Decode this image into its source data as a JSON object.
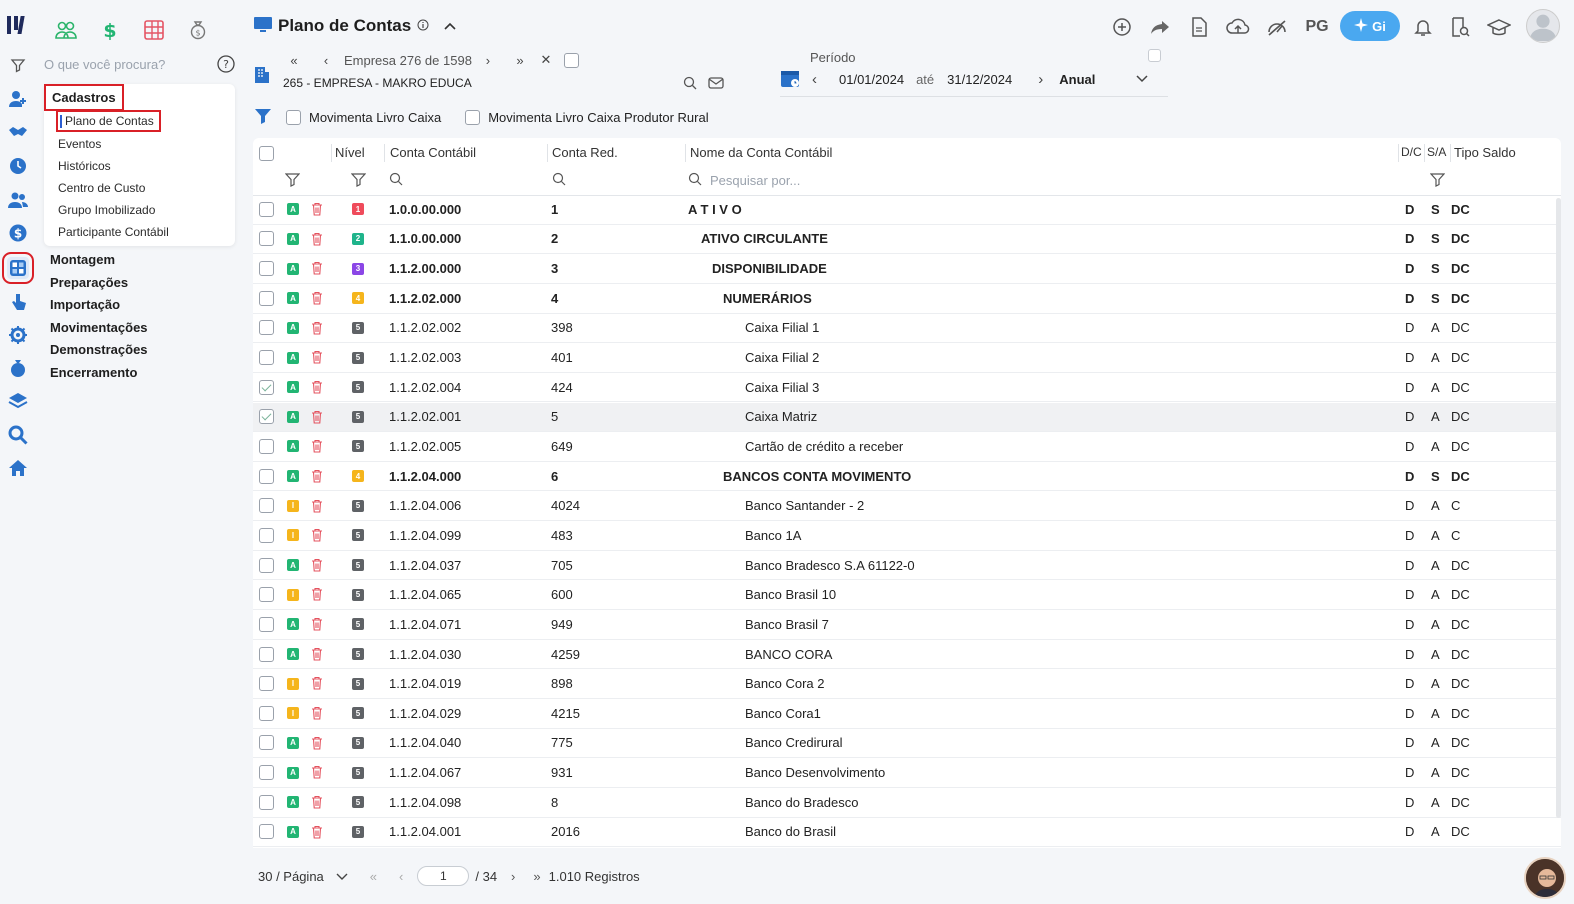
{
  "app": {
    "title": "Plano de Contas",
    "pg_label": "PG",
    "gi_label": "Gi"
  },
  "sidebar": {
    "search_placeholder": "O que você procura?",
    "submenu_header": "Cadastros",
    "submenu_items": [
      "Plano de Contas",
      "Eventos",
      "Históricos",
      "Centro de Custo",
      "Grupo Imobilizado",
      "Participante Contábil"
    ],
    "main_items": [
      "Montagem",
      "Preparações",
      "Importação",
      "Movimentações",
      "Demonstrações",
      "Encerramento"
    ]
  },
  "empresa": {
    "counter": "Empresa 276 de 1598",
    "name": "265 - EMPRESA - MAKRO EDUCA"
  },
  "periodo": {
    "label": "Período",
    "start": "01/01/2024",
    "sep": "até",
    "end": "31/12/2024",
    "type": "Anual"
  },
  "filters": {
    "livro_caixa": "Movimenta Livro Caixa",
    "livro_caixa_rural": "Movimenta Livro Caixa Produtor Rural"
  },
  "table": {
    "headers": {
      "nivel": "Nível",
      "conta": "Conta Contábil",
      "red": "Conta Red.",
      "nome": "Nome da Conta Contábil",
      "dc": "D/C",
      "sa": "S/A",
      "tipo": "Tipo Saldo"
    },
    "search_placeholder": "Pesquisar por...",
    "rows": [
      {
        "checked": false,
        "status": "A",
        "level": "1",
        "conta": "1.0.0.00.000",
        "red": "1",
        "nome": "A T I V O",
        "dc": "D",
        "sa": "S",
        "tipo": "DC",
        "bold": true
      },
      {
        "checked": false,
        "status": "A",
        "level": "2",
        "conta": "1.1.0.00.000",
        "red": "2",
        "nome": "ATIVO CIRCULANTE",
        "dc": "D",
        "sa": "S",
        "tipo": "DC",
        "bold": true
      },
      {
        "checked": false,
        "status": "A",
        "level": "3",
        "conta": "1.1.2.00.000",
        "red": "3",
        "nome": "DISPONIBILIDADE",
        "dc": "D",
        "sa": "S",
        "tipo": "DC",
        "bold": true
      },
      {
        "checked": false,
        "status": "A",
        "level": "4",
        "conta": "1.1.2.02.000",
        "red": "4",
        "nome": "NUMERÁRIOS",
        "dc": "D",
        "sa": "S",
        "tipo": "DC",
        "bold": true
      },
      {
        "checked": false,
        "status": "A",
        "level": "5",
        "conta": "1.1.2.02.002",
        "red": "398",
        "nome": "Caixa Filial 1",
        "dc": "D",
        "sa": "A",
        "tipo": "DC",
        "bold": false
      },
      {
        "checked": false,
        "status": "A",
        "level": "5",
        "conta": "1.1.2.02.003",
        "red": "401",
        "nome": "Caixa Filial 2",
        "dc": "D",
        "sa": "A",
        "tipo": "DC",
        "bold": false
      },
      {
        "checked": true,
        "status": "A",
        "level": "5",
        "conta": "1.1.2.02.004",
        "red": "424",
        "nome": "Caixa Filial 3",
        "dc": "D",
        "sa": "A",
        "tipo": "DC",
        "bold": false
      },
      {
        "checked": true,
        "status": "A",
        "level": "5",
        "conta": "1.1.2.02.001",
        "red": "5",
        "nome": "Caixa Matriz",
        "dc": "D",
        "sa": "A",
        "tipo": "DC",
        "bold": false,
        "hl": true
      },
      {
        "checked": false,
        "status": "A",
        "level": "5",
        "conta": "1.1.2.02.005",
        "red": "649",
        "nome": "Cartão de crédito a receber",
        "dc": "D",
        "sa": "A",
        "tipo": "DC",
        "bold": false
      },
      {
        "checked": false,
        "status": "A",
        "level": "4",
        "conta": "1.1.2.04.000",
        "red": "6",
        "nome": "BANCOS CONTA MOVIMENTO",
        "dc": "D",
        "sa": "S",
        "tipo": "DC",
        "bold": true
      },
      {
        "checked": false,
        "status": "I",
        "level": "5",
        "conta": "1.1.2.04.006",
        "red": "4024",
        "nome": "Banco Santander - 2",
        "dc": "D",
        "sa": "A",
        "tipo": "C",
        "bold": false
      },
      {
        "checked": false,
        "status": "I",
        "level": "5",
        "conta": "1.1.2.04.099",
        "red": "483",
        "nome": "Banco 1A",
        "dc": "D",
        "sa": "A",
        "tipo": "C",
        "bold": false
      },
      {
        "checked": false,
        "status": "A",
        "level": "5",
        "conta": "1.1.2.04.037",
        "red": "705",
        "nome": "Banco Bradesco S.A 61122-0",
        "dc": "D",
        "sa": "A",
        "tipo": "DC",
        "bold": false
      },
      {
        "checked": false,
        "status": "I",
        "level": "5",
        "conta": "1.1.2.04.065",
        "red": "600",
        "nome": "Banco Brasil 10",
        "dc": "D",
        "sa": "A",
        "tipo": "DC",
        "bold": false
      },
      {
        "checked": false,
        "status": "A",
        "level": "5",
        "conta": "1.1.2.04.071",
        "red": "949",
        "nome": "Banco Brasil 7",
        "dc": "D",
        "sa": "A",
        "tipo": "DC",
        "bold": false
      },
      {
        "checked": false,
        "status": "A",
        "level": "5",
        "conta": "1.1.2.04.030",
        "red": "4259",
        "nome": "BANCO CORA",
        "dc": "D",
        "sa": "A",
        "tipo": "DC",
        "bold": false
      },
      {
        "checked": false,
        "status": "I",
        "level": "5",
        "conta": "1.1.2.04.019",
        "red": "898",
        "nome": "Banco Cora 2",
        "dc": "D",
        "sa": "A",
        "tipo": "DC",
        "bold": false
      },
      {
        "checked": false,
        "status": "I",
        "level": "5",
        "conta": "1.1.2.04.029",
        "red": "4215",
        "nome": "Banco Cora1",
        "dc": "D",
        "sa": "A",
        "tipo": "DC",
        "bold": false
      },
      {
        "checked": false,
        "status": "A",
        "level": "5",
        "conta": "1.1.2.04.040",
        "red": "775",
        "nome": "Banco Credirural",
        "dc": "D",
        "sa": "A",
        "tipo": "DC",
        "bold": false
      },
      {
        "checked": false,
        "status": "A",
        "level": "5",
        "conta": "1.1.2.04.067",
        "red": "931",
        "nome": "Banco Desenvolvimento",
        "dc": "D",
        "sa": "A",
        "tipo": "DC",
        "bold": false
      },
      {
        "checked": false,
        "status": "A",
        "level": "5",
        "conta": "1.1.2.04.098",
        "red": "8",
        "nome": "Banco do Bradesco",
        "dc": "D",
        "sa": "A",
        "tipo": "DC",
        "bold": false
      },
      {
        "checked": false,
        "status": "A",
        "level": "5",
        "conta": "1.1.2.04.001",
        "red": "2016",
        "nome": "Banco do Brasil",
        "dc": "D",
        "sa": "A",
        "tipo": "DC",
        "bold": false
      }
    ]
  },
  "footer": {
    "per_page": "30 / Página",
    "current_page": "1",
    "total_pages": "/ 34",
    "records": "1.010 Registros"
  },
  "colors": {
    "status_A": "#22b573",
    "status_I": "#f5b51c",
    "level_1": "#ef4b5b",
    "level_2": "#1fb48b",
    "level_3": "#8b46e6",
    "level_4": "#f5b51c",
    "level_5": "#5f6266",
    "accent": "#2b5dd1",
    "highlight": "#d92027"
  }
}
